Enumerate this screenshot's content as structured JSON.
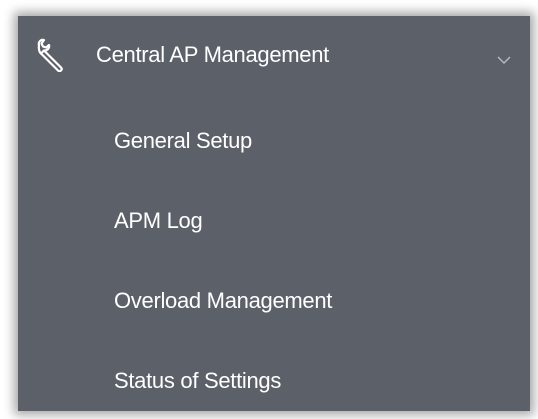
{
  "menu": {
    "header": {
      "label": "Central AP Management",
      "icon": "wrench-icon",
      "expanded": true
    },
    "items": [
      {
        "label": "General Setup"
      },
      {
        "label": "APM Log"
      },
      {
        "label": "Overload Management"
      },
      {
        "label": "Status of Settings"
      }
    ]
  },
  "colors": {
    "panel_background": "#5c6069",
    "text": "#ffffff",
    "chevron": "#b8bcc4"
  }
}
